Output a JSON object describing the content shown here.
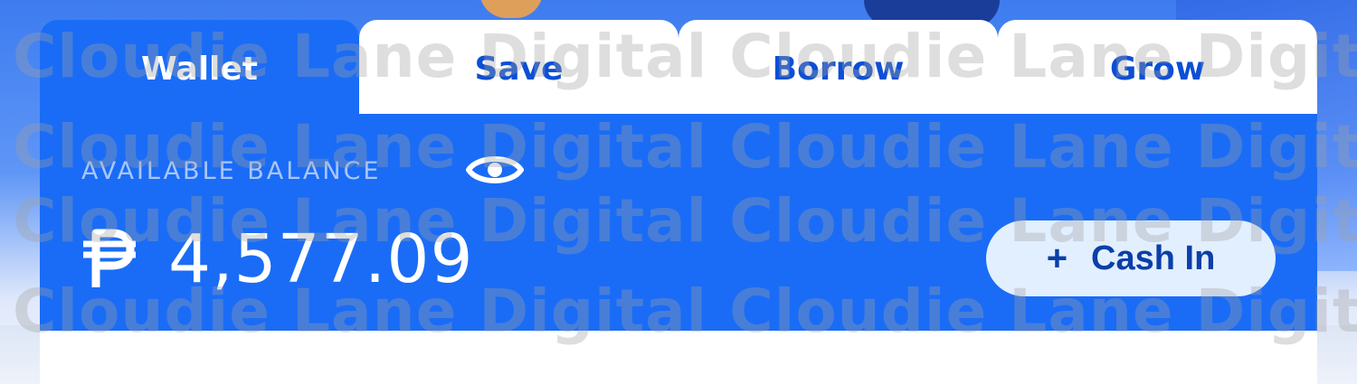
{
  "tabs": [
    {
      "label": "Wallet",
      "active": true
    },
    {
      "label": "Save",
      "active": false
    },
    {
      "label": "Borrow",
      "active": false
    },
    {
      "label": "Grow",
      "active": false
    }
  ],
  "balance": {
    "label": "AVAILABLE BALANCE",
    "currency_icon": "peso-sign",
    "amount": "4,577.09",
    "visibility_icon": "eye-icon"
  },
  "cash_in": {
    "icon": "plus-icon",
    "plus_symbol": "+",
    "label": "Cash In"
  },
  "watermark": {
    "text": "Cloudie Lane Digital Cloudie Lane Digital"
  },
  "colors": {
    "primary": "#1a6cf6",
    "tab_text": "#0b4fd6",
    "cash_in_bg": "#e2efff"
  }
}
